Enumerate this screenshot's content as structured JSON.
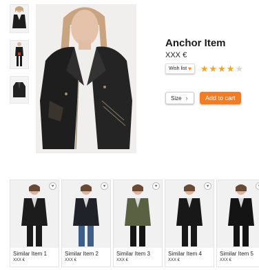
{
  "product": {
    "title": "Anchor Item",
    "price": "XXX €",
    "wishlist_label": "Wish list",
    "rating": 4,
    "rating_max": 5,
    "size_label": "Size",
    "add_to_cart_label": "Add to cart",
    "accent_color": "#f47b20",
    "star_filled_color": "#f6a321",
    "star_empty_color": "#d6d6d6"
  },
  "thumbnails": [
    {
      "alt": "jacket-front-thumb"
    },
    {
      "alt": "jacket-full-thumb"
    },
    {
      "alt": "jacket-flat-thumb"
    }
  ],
  "similar_items": [
    {
      "name": "Similar Item 1",
      "price": "XXX €",
      "jacket_color": "#1c1c1c",
      "pants_color": "#1a1a1a"
    },
    {
      "name": "Similar Item 2",
      "price": "XXX €",
      "jacket_color": "#1f2228",
      "pants_color": "#3b5f8a"
    },
    {
      "name": "Similar Item 3",
      "price": "XXX €",
      "jacket_color": "#5a6142",
      "pants_color": "#151515"
    },
    {
      "name": "Similar Item 4",
      "price": "XXX €",
      "jacket_color": "#181818",
      "pants_color": "#181818"
    },
    {
      "name": "Similar Item 5",
      "price": "XXX €",
      "jacket_color": "#141414",
      "pants_color": "#141414"
    }
  ]
}
